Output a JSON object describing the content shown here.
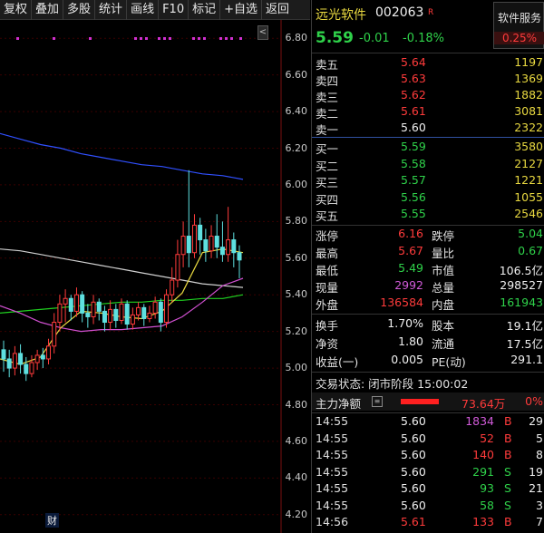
{
  "toolbar": [
    "复权",
    "叠加",
    "多股",
    "统计",
    "画线",
    "F10",
    "标记",
    "+自选",
    "返回"
  ],
  "chart": {
    "y_axis": [
      "6.80",
      "6.60",
      "6.40",
      "6.20",
      "6.00",
      "5.80",
      "5.60",
      "5.40",
      "5.20",
      "5.00",
      "4.80",
      "4.60",
      "4.40",
      "4.20"
    ],
    "cai_badge": "财",
    "side_button": "<"
  },
  "chart_data": {
    "type": "candlestick",
    "y_range": [
      4.1,
      6.9
    ],
    "candles": [
      [
        5.1,
        5.05,
        5.15,
        4.98
      ],
      [
        5.05,
        5.0,
        5.1,
        4.95
      ],
      [
        5.0,
        5.08,
        5.12,
        4.96
      ],
      [
        5.08,
        5.02,
        5.13,
        4.97
      ],
      [
        5.02,
        4.97,
        5.06,
        4.93
      ],
      [
        4.97,
        5.03,
        5.07,
        4.95
      ],
      [
        5.03,
        5.07,
        5.1,
        4.99
      ],
      [
        5.07,
        5.05,
        5.11,
        5.0
      ],
      [
        5.05,
        5.12,
        5.16,
        5.02
      ],
      [
        5.12,
        5.25,
        5.3,
        5.08
      ],
      [
        5.25,
        5.35,
        5.4,
        5.2
      ],
      [
        5.35,
        5.38,
        5.43,
        5.25
      ],
      [
        5.38,
        5.31,
        5.4,
        5.26
      ],
      [
        5.31,
        5.4,
        5.44,
        5.28
      ],
      [
        5.4,
        5.3,
        5.42,
        5.25
      ],
      [
        5.3,
        5.28,
        5.35,
        5.22
      ],
      [
        5.28,
        5.36,
        5.4,
        5.24
      ],
      [
        5.36,
        5.31,
        5.38,
        5.26
      ],
      [
        5.31,
        5.25,
        5.34,
        5.2
      ],
      [
        5.25,
        5.32,
        5.37,
        5.21
      ],
      [
        5.32,
        5.26,
        5.35,
        5.22
      ],
      [
        5.26,
        5.35,
        5.38,
        5.24
      ],
      [
        5.35,
        5.24,
        5.37,
        5.21
      ],
      [
        5.24,
        5.29,
        5.33,
        5.21
      ],
      [
        5.29,
        5.33,
        5.36,
        5.26
      ],
      [
        5.33,
        5.27,
        5.35,
        5.23
      ],
      [
        5.27,
        5.3,
        5.34,
        5.25
      ],
      [
        5.3,
        5.36,
        5.39,
        5.27
      ],
      [
        5.36,
        5.25,
        5.38,
        5.2
      ],
      [
        5.25,
        5.4,
        5.43,
        5.22
      ],
      [
        5.4,
        5.48,
        5.55,
        5.36
      ],
      [
        5.48,
        5.62,
        5.7,
        5.44
      ],
      [
        5.62,
        5.72,
        5.8,
        5.55
      ],
      [
        5.72,
        5.63,
        6.08,
        5.55
      ],
      [
        5.63,
        5.78,
        5.84,
        5.6
      ],
      [
        5.78,
        5.7,
        5.82,
        5.62
      ],
      [
        5.7,
        5.64,
        5.76,
        5.58
      ],
      [
        5.64,
        5.72,
        5.78,
        5.6
      ],
      [
        5.72,
        5.66,
        5.84,
        5.6
      ],
      [
        5.66,
        5.62,
        5.8,
        5.58
      ],
      [
        5.62,
        5.7,
        5.88,
        5.58
      ],
      [
        5.7,
        5.63,
        5.74,
        5.55
      ],
      [
        5.63,
        5.59,
        5.67,
        5.49
      ]
    ],
    "ma_lines": [
      {
        "color": "#3050ff",
        "values": [
          6.28,
          6.25,
          6.22,
          6.2,
          6.17,
          6.15,
          6.13,
          6.11,
          6.1,
          6.08,
          6.06,
          6.05,
          6.03
        ]
      },
      {
        "color": "#d0d0d0",
        "values": [
          5.65,
          5.64,
          5.62,
          5.6,
          5.58,
          5.56,
          5.54,
          5.52,
          5.5,
          5.48,
          5.46,
          5.45,
          5.44
        ]
      },
      {
        "color": "#20d020",
        "values": [
          5.3,
          5.31,
          5.32,
          5.33,
          5.34,
          5.35,
          5.36,
          5.36,
          5.37,
          5.37,
          5.38,
          5.38,
          5.4
        ]
      },
      {
        "color": "#d050d0",
        "values": [
          5.34,
          5.3,
          5.25,
          5.22,
          5.2,
          5.21,
          5.21,
          5.22,
          5.23,
          5.28,
          5.36,
          5.45,
          5.49
        ]
      },
      {
        "color": "#e8d840",
        "values": [
          5.05,
          5.02,
          5.06,
          5.22,
          5.31,
          5.3,
          5.28,
          5.27,
          5.31,
          5.41,
          5.63,
          5.65,
          5.63
        ]
      }
    ]
  },
  "quote": {
    "name": "远光软件",
    "code": "002063",
    "tag": "R",
    "service": "软件服务",
    "price": "5.59",
    "change": "-0.01",
    "change_pct": "-0.18%",
    "sector_pct": "0.25%"
  },
  "orderbook": {
    "asks": [
      {
        "label": "卖五",
        "price": "5.64",
        "vol": "1197"
      },
      {
        "label": "卖四",
        "price": "5.63",
        "vol": "1369"
      },
      {
        "label": "卖三",
        "price": "5.62",
        "vol": "1882"
      },
      {
        "label": "卖二",
        "price": "5.61",
        "vol": "3081"
      },
      {
        "label": "卖一",
        "price": "5.60",
        "vol": "2322"
      }
    ],
    "bids": [
      {
        "label": "买一",
        "price": "5.59",
        "vol": "3580"
      },
      {
        "label": "买二",
        "price": "5.58",
        "vol": "2127"
      },
      {
        "label": "买三",
        "price": "5.57",
        "vol": "1221"
      },
      {
        "label": "买四",
        "price": "5.56",
        "vol": "1055"
      },
      {
        "label": "买五",
        "price": "5.55",
        "vol": "2546"
      }
    ]
  },
  "stats": {
    "zt_l": "涨停",
    "zt_v": "6.16",
    "dt_l": "跌停",
    "dt_v": "5.04",
    "zg_l": "最高",
    "zg_v": "5.67",
    "lb_l": "量比",
    "lb_v": "0.67",
    "zd_l": "最低",
    "zd_v": "5.49",
    "sz_l": "市值",
    "sz_v": "106.5亿",
    "xl_l": "现量",
    "xl_v": "2992",
    "zl_l": "总量",
    "zl_v": "298527",
    "wp_l": "外盘",
    "wp_v": "136584",
    "np_l": "内盘",
    "np_v": "161943",
    "hs_l": "换手",
    "hs_v": "1.70%",
    "gb_l": "股本",
    "gb_v": "19.1亿",
    "jz_l": "净资",
    "jz_v": "1.80",
    "lt_l": "流通",
    "lt_v": "17.5亿",
    "sy_l": "收益(一)",
    "sy_v": "0.005",
    "pe_l": "PE(动)",
    "pe_v": "291.1"
  },
  "status": {
    "text": "交易状态: 闭市阶段 15:00:02",
    "main_label": "主力净额",
    "main_value": "73.64万",
    "main_pct": "0%"
  },
  "trades": [
    {
      "t": "14:55",
      "p": "5.60",
      "v": "1834",
      "s": "B",
      "n": "29"
    },
    {
      "t": "14:55",
      "p": "5.60",
      "v": "52",
      "s": "B",
      "n": "5"
    },
    {
      "t": "14:55",
      "p": "5.60",
      "v": "140",
      "s": "B",
      "n": "8"
    },
    {
      "t": "14:55",
      "p": "5.60",
      "v": "291",
      "s": "S",
      "n": "19"
    },
    {
      "t": "14:55",
      "p": "5.60",
      "v": "93",
      "s": "S",
      "n": "21"
    },
    {
      "t": "14:55",
      "p": "5.60",
      "v": "58",
      "s": "S",
      "n": "3"
    },
    {
      "t": "14:56",
      "p": "5.61",
      "v": "133",
      "s": "B",
      "n": "7"
    }
  ]
}
